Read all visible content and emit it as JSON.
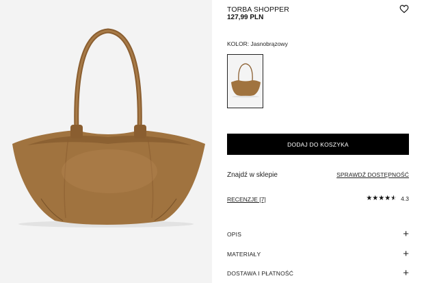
{
  "product": {
    "title": "TORBA SHOPPER",
    "price": "127,99 PLN"
  },
  "icons": {
    "favorite": "heart-outline-icon",
    "expand": "plus-icon",
    "star": "star-icon"
  },
  "colors": {
    "bag": "#a0733f",
    "bag_shadow": "#7e5529",
    "gallery_bg": "#f3f3f3",
    "button_bg": "#000000",
    "button_text": "#ffffff"
  },
  "color_selector": {
    "label": "KOLOR: Jasnobrązowy"
  },
  "add_to_cart": {
    "label": "DODAJ DO KOSZYKA"
  },
  "store": {
    "label": "Znajdź w sklepie",
    "availability_link": "SPRAWDŹ DOSTĘPNOŚĆ"
  },
  "reviews": {
    "link": "RECENZJE [7]",
    "rating": "4.3",
    "stars_filled": 4,
    "stars_total": 5
  },
  "accordion": [
    {
      "label": "OPIS",
      "icon": "+"
    },
    {
      "label": "MATERIAŁY",
      "icon": "+"
    },
    {
      "label": "DOSTAWA I PŁATNOŚĆ",
      "icon": "+"
    }
  ]
}
